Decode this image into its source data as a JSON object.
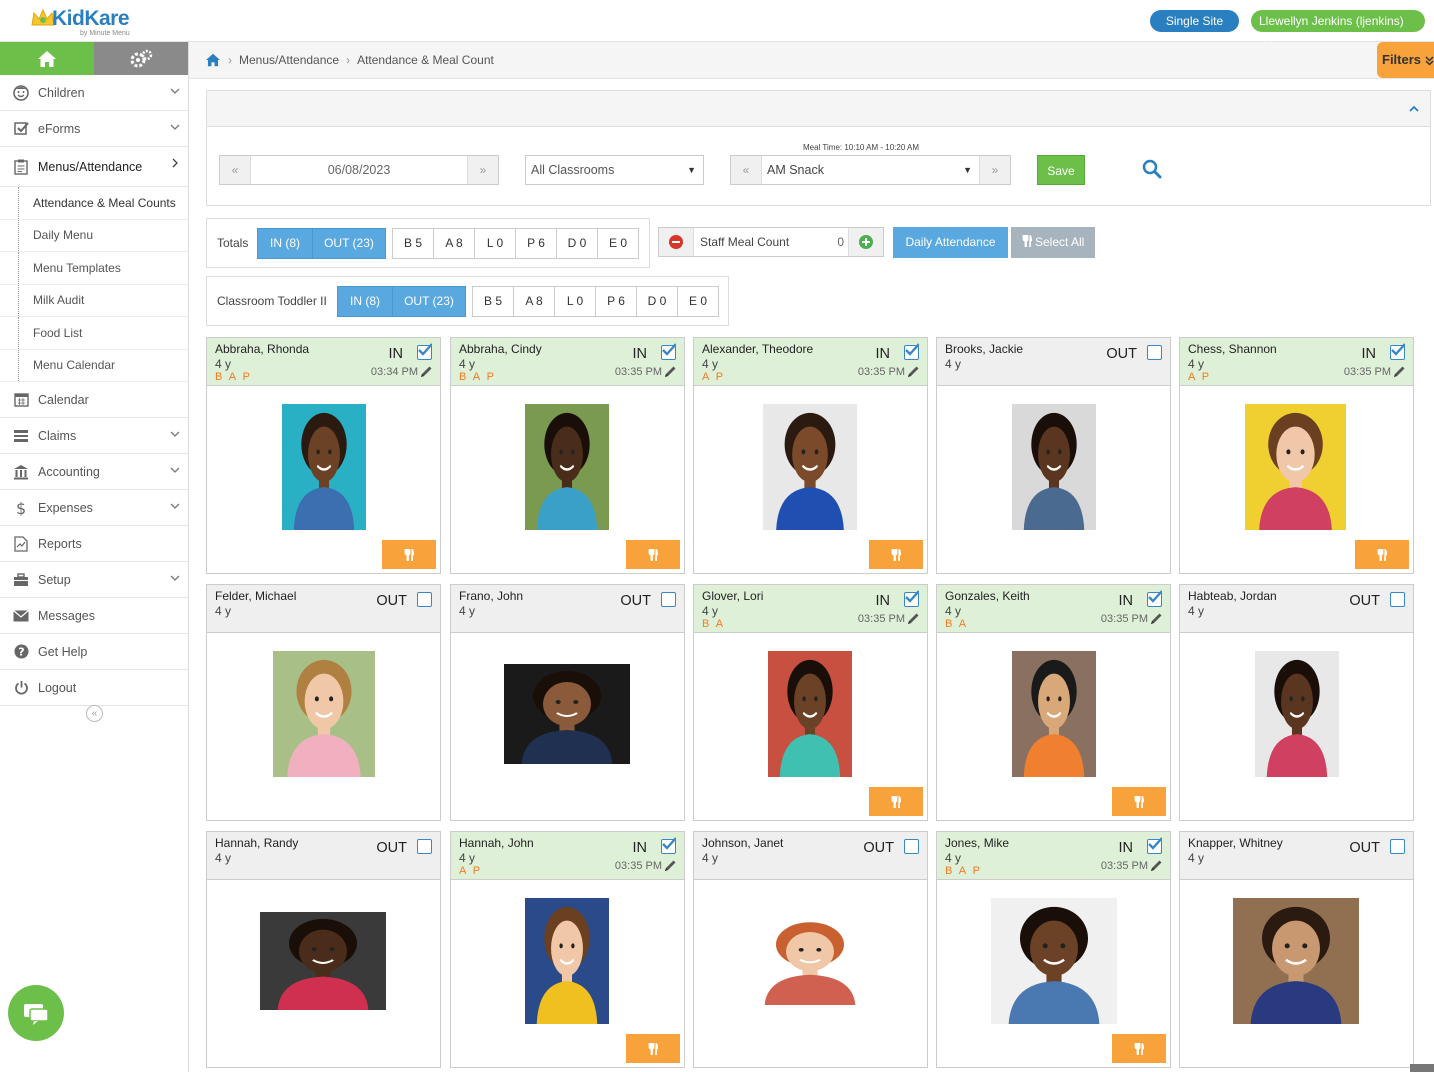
{
  "header": {
    "brand": "KidKare",
    "brand_sub": "by Minute Menu",
    "site_button": "Single Site",
    "user_button": "Llewellyn Jenkins (ljenkins)"
  },
  "sidebar": {
    "items": [
      {
        "label": "Children",
        "icon": "child-face-icon",
        "expandable": true
      },
      {
        "label": "eForms",
        "icon": "checkbox-icon",
        "expandable": true
      },
      {
        "label": "Menus/Attendance",
        "icon": "clipboard-icon",
        "expandable": true,
        "open": true
      },
      {
        "label": "Calendar",
        "icon": "calendar-icon",
        "expandable": false
      },
      {
        "label": "Claims",
        "icon": "claims-icon",
        "expandable": true
      },
      {
        "label": "Accounting",
        "icon": "bank-icon",
        "expandable": true
      },
      {
        "label": "Expenses",
        "icon": "dollar-icon",
        "expandable": true
      },
      {
        "label": "Reports",
        "icon": "report-icon",
        "expandable": false
      },
      {
        "label": "Setup",
        "icon": "briefcase-icon",
        "expandable": true
      },
      {
        "label": "Messages",
        "icon": "envelope-icon",
        "expandable": false
      },
      {
        "label": "Get Help",
        "icon": "question-icon",
        "expandable": false
      },
      {
        "label": "Logout",
        "icon": "power-icon",
        "expandable": false
      }
    ],
    "subitems": [
      "Attendance & Meal Counts",
      "Daily Menu",
      "Menu Templates",
      "Milk Audit",
      "Food List",
      "Menu Calendar"
    ],
    "collapse_glyph": "«"
  },
  "breadcrumb": {
    "items": [
      "Menus/Attendance",
      "Attendance & Meal Count"
    ],
    "filters_label": "Filters"
  },
  "controls": {
    "date": "06/08/2023",
    "classroom": "All Classrooms",
    "meal": "AM Snack",
    "meal_time": "Meal Time: 10:10 AM - 10:20 AM",
    "save": "Save",
    "prev": "«",
    "next": "»"
  },
  "totals": {
    "label": "Totals",
    "in": "IN (8)",
    "out": "OUT (23)",
    "meals": [
      "B 5",
      "A 8",
      "L 0",
      "P 6",
      "D 0",
      "E 0"
    ]
  },
  "classroom_totals": {
    "label": "Classroom Toddler II",
    "in": "IN (8)",
    "out": "OUT (23)",
    "meals": [
      "B 5",
      "A 8",
      "L 0",
      "P 6",
      "D 0",
      "E 0"
    ]
  },
  "staff": {
    "label": "Staff Meal Count",
    "value": "0"
  },
  "actions": {
    "daily_attendance": "Daily Attendance",
    "select_all": "Select All"
  },
  "colors": {
    "brand_blue": "#2a7fc0",
    "green": "#6cc04a",
    "orange": "#f7a23a",
    "in_bg": "#dff0d8",
    "meal_text": "#f47b20"
  },
  "children": [
    {
      "name": "Abbraha, Rhonda",
      "age": "4 y",
      "status": "IN",
      "checked": true,
      "time": "03:34 PM",
      "meals": "B A P"
    },
    {
      "name": "Abbraha, Cindy",
      "age": "4 y",
      "status": "IN",
      "checked": true,
      "time": "03:35 PM",
      "meals": "B A P"
    },
    {
      "name": "Alexander, Theodore",
      "age": "4 y",
      "status": "IN",
      "checked": true,
      "time": "03:35 PM",
      "meals": "A P"
    },
    {
      "name": "Brooks, Jackie",
      "age": "4 y",
      "status": "OUT",
      "checked": false,
      "time": "",
      "meals": ""
    },
    {
      "name": "Chess, Shannon",
      "age": "4 y",
      "status": "IN",
      "checked": true,
      "time": "03:35 PM",
      "meals": "A P"
    },
    {
      "name": "Felder, Michael",
      "age": "4 y",
      "status": "OUT",
      "checked": false,
      "time": "",
      "meals": ""
    },
    {
      "name": "Frano, John",
      "age": "4 y",
      "status": "OUT",
      "checked": false,
      "time": "",
      "meals": ""
    },
    {
      "name": "Glover, Lori",
      "age": "4 y",
      "status": "IN",
      "checked": true,
      "time": "03:35 PM",
      "meals": "B A"
    },
    {
      "name": "Gonzales, Keith",
      "age": "4 y",
      "status": "IN",
      "checked": true,
      "time": "03:35 PM",
      "meals": "B A"
    },
    {
      "name": "Habteab, Jordan",
      "age": "4 y",
      "status": "OUT",
      "checked": false,
      "time": "",
      "meals": ""
    },
    {
      "name": "Hannah, Randy",
      "age": "4 y",
      "status": "OUT",
      "checked": false,
      "time": "",
      "meals": ""
    },
    {
      "name": "Hannah, John",
      "age": "4 y",
      "status": "IN",
      "checked": true,
      "time": "03:35 PM",
      "meals": "A P"
    },
    {
      "name": "Johnson, Janet",
      "age": "4 y",
      "status": "OUT",
      "checked": false,
      "time": "",
      "meals": ""
    },
    {
      "name": "Jones, Mike",
      "age": "4 y",
      "status": "IN",
      "checked": true,
      "time": "03:35 PM",
      "meals": "B A P"
    },
    {
      "name": "Knapper, Whitney",
      "age": "4 y",
      "status": "OUT",
      "checked": false,
      "time": "",
      "meals": ""
    }
  ]
}
